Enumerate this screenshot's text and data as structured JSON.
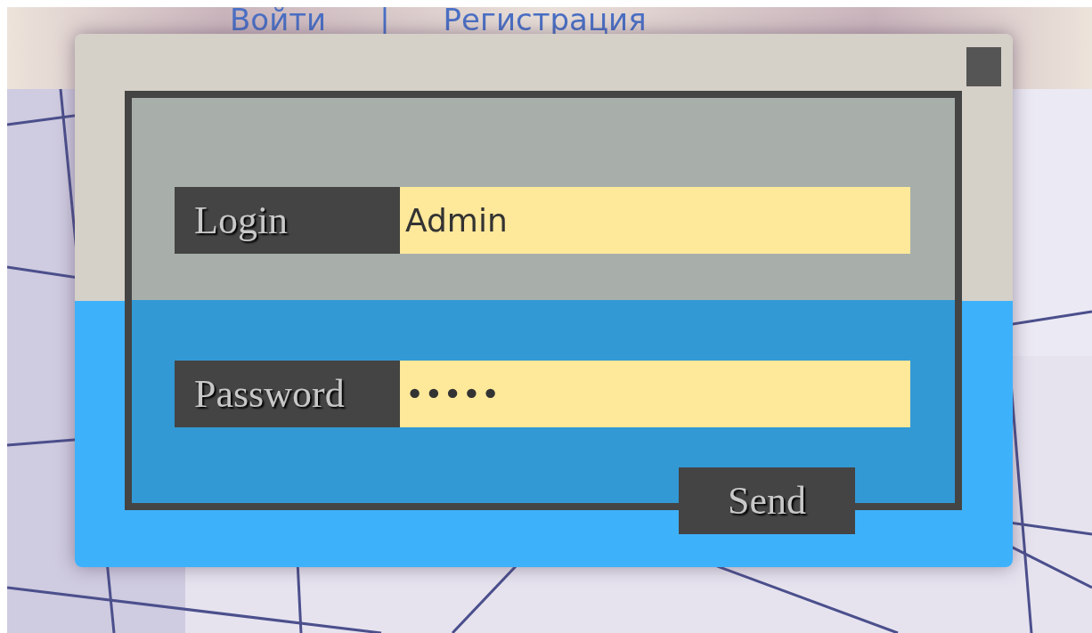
{
  "header": {
    "links": [
      {
        "label": "Войти"
      },
      {
        "label": "|"
      },
      {
        "label": "Регистрация"
      }
    ]
  },
  "dialog": {
    "fields": [
      {
        "label": "Login",
        "value": "Admin"
      },
      {
        "label": "Password",
        "value": "•••••"
      }
    ],
    "submit": "Send"
  }
}
